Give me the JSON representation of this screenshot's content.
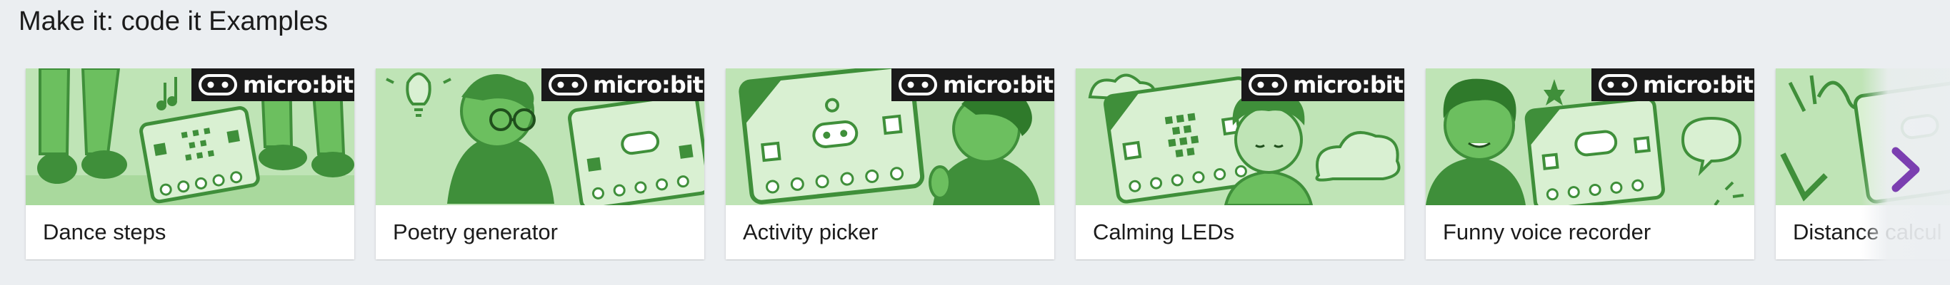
{
  "section": {
    "title": "Make it: code it Examples"
  },
  "badge": {
    "text": "micro:bit",
    "icon": "microbit-face-icon"
  },
  "cards": [
    {
      "label": "Dance steps"
    },
    {
      "label": "Poetry generator"
    },
    {
      "label": "Activity picker"
    },
    {
      "label": "Calming LEDs"
    },
    {
      "label": "Funny voice recorder"
    },
    {
      "label": "Distance calcul"
    }
  ],
  "navigation": {
    "next_icon": "chevron-right-icon"
  },
  "colors": {
    "background": "#ebeef1",
    "card_image_bg": "#bfe4b6",
    "illustration_dark": "#3f8f3a",
    "illustration_mid": "#6cbf5f",
    "badge_bg": "#1a1a1a",
    "next_chevron": "#7b3fb0"
  }
}
